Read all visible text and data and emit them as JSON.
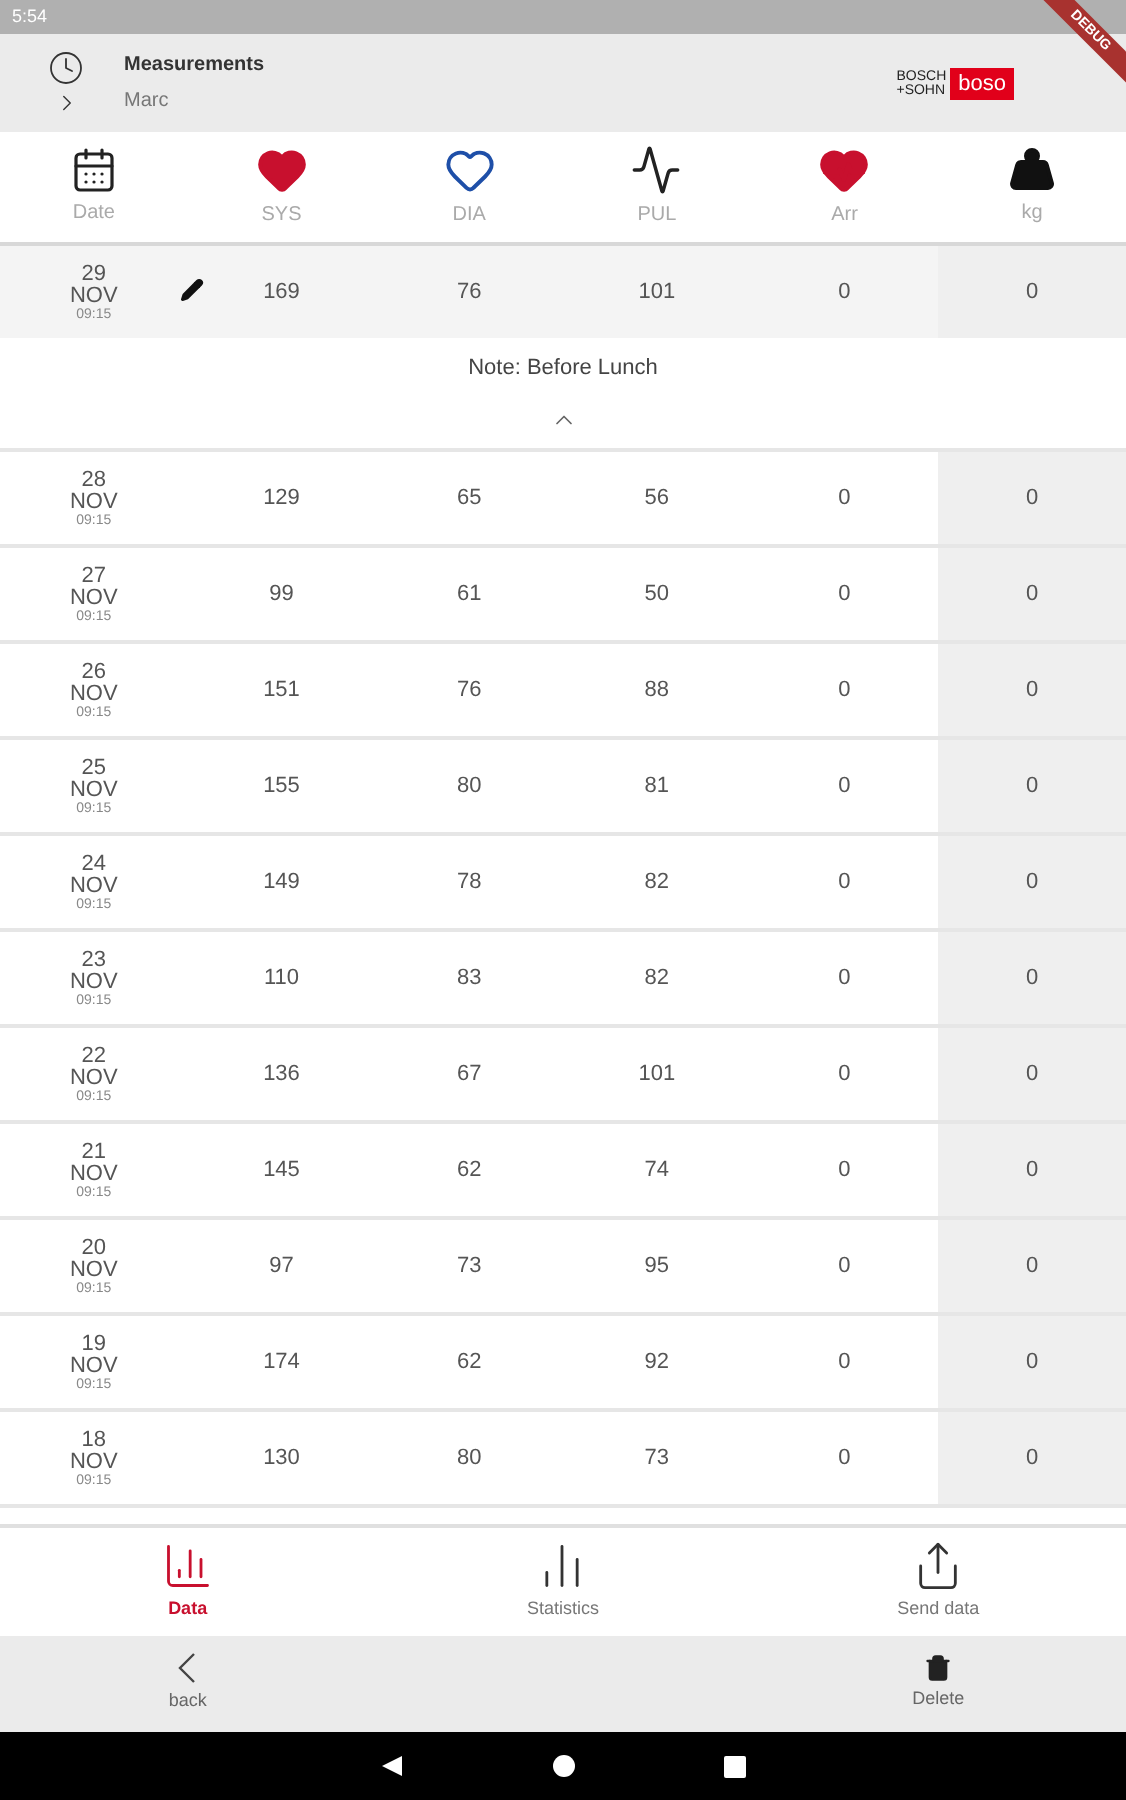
{
  "status_bar": {
    "time": "5:54"
  },
  "debug_banner": "DEBUG",
  "header": {
    "title": "Measurements",
    "subtitle": "Marc",
    "logo": {
      "top": "BOSCH",
      "bottom": "+SOHN",
      "brand": "boso"
    }
  },
  "columns": [
    {
      "kind": "date",
      "label": "Date"
    },
    {
      "kind": "sys",
      "label": "SYS"
    },
    {
      "kind": "dia",
      "label": "DIA"
    },
    {
      "kind": "pul",
      "label": "PUL"
    },
    {
      "kind": "arr",
      "label": "Arr"
    },
    {
      "kind": "kg",
      "label": "kg"
    }
  ],
  "rows": [
    {
      "day": "29",
      "month": "NOV",
      "time": "09:15",
      "sys": "169",
      "dia": "76",
      "pul": "101",
      "arr": "0",
      "kg": "0",
      "expanded": true,
      "note": "Note: Before Lunch"
    },
    {
      "day": "28",
      "month": "NOV",
      "time": "09:15",
      "sys": "129",
      "dia": "65",
      "pul": "56",
      "arr": "0",
      "kg": "0",
      "expanded": false
    },
    {
      "day": "27",
      "month": "NOV",
      "time": "09:15",
      "sys": "99",
      "dia": "61",
      "pul": "50",
      "arr": "0",
      "kg": "0",
      "expanded": false
    },
    {
      "day": "26",
      "month": "NOV",
      "time": "09:15",
      "sys": "151",
      "dia": "76",
      "pul": "88",
      "arr": "0",
      "kg": "0",
      "expanded": false
    },
    {
      "day": "25",
      "month": "NOV",
      "time": "09:15",
      "sys": "155",
      "dia": "80",
      "pul": "81",
      "arr": "0",
      "kg": "0",
      "expanded": false
    },
    {
      "day": "24",
      "month": "NOV",
      "time": "09:15",
      "sys": "149",
      "dia": "78",
      "pul": "82",
      "arr": "0",
      "kg": "0",
      "expanded": false
    },
    {
      "day": "23",
      "month": "NOV",
      "time": "09:15",
      "sys": "110",
      "dia": "83",
      "pul": "82",
      "arr": "0",
      "kg": "0",
      "expanded": false
    },
    {
      "day": "22",
      "month": "NOV",
      "time": "09:15",
      "sys": "136",
      "dia": "67",
      "pul": "101",
      "arr": "0",
      "kg": "0",
      "expanded": false
    },
    {
      "day": "21",
      "month": "NOV",
      "time": "09:15",
      "sys": "145",
      "dia": "62",
      "pul": "74",
      "arr": "0",
      "kg": "0",
      "expanded": false
    },
    {
      "day": "20",
      "month": "NOV",
      "time": "09:15",
      "sys": "97",
      "dia": "73",
      "pul": "95",
      "arr": "0",
      "kg": "0",
      "expanded": false
    },
    {
      "day": "19",
      "month": "NOV",
      "time": "09:15",
      "sys": "174",
      "dia": "62",
      "pul": "92",
      "arr": "0",
      "kg": "0",
      "expanded": false
    },
    {
      "day": "18",
      "month": "NOV",
      "time": "09:15",
      "sys": "130",
      "dia": "80",
      "pul": "73",
      "arr": "0",
      "kg": "0",
      "expanded": false
    }
  ],
  "bottom_nav": [
    {
      "kind": "data",
      "label": "Data",
      "selected": true
    },
    {
      "kind": "statistics",
      "label": "Statistics",
      "selected": false
    },
    {
      "kind": "send",
      "label": "Send data",
      "selected": false
    }
  ],
  "action_bar": [
    {
      "kind": "back",
      "label": "back"
    },
    {
      "kind": "delete",
      "label": "Delete"
    }
  ]
}
